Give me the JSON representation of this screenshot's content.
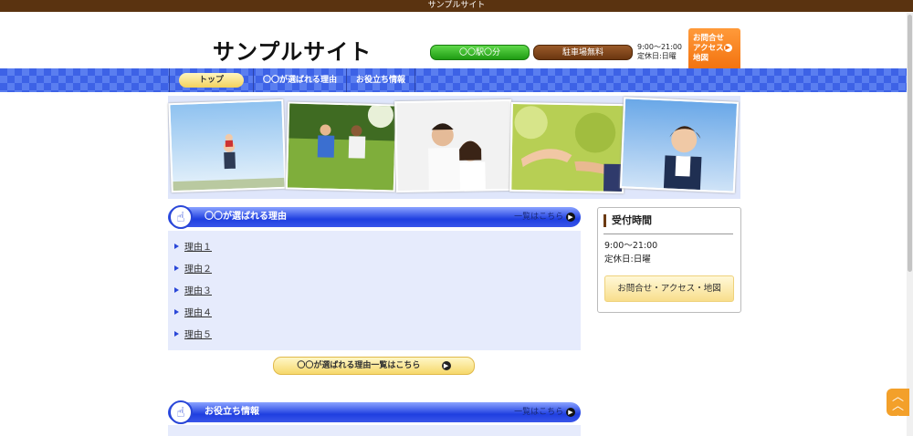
{
  "topbar": {
    "title": "サンプルサイト"
  },
  "header": {
    "site_title": "サンプルサイト",
    "station_label": "〇〇駅〇分",
    "parking_label": "駐車場無料",
    "hours": "9:00～21:00",
    "closed": "定休日:日曜",
    "contact_line1": "お問合せ",
    "contact_line2": "アクセス",
    "contact_line3": "地図"
  },
  "nav": {
    "items": [
      {
        "label": "トップ"
      },
      {
        "label": "〇〇が選ばれる理由"
      },
      {
        "label": "お役立ち情報"
      }
    ]
  },
  "reasons_section": {
    "title": "〇〇が選ばれる理由",
    "link": "一覧はこちら",
    "items": [
      "理由１",
      "理由２",
      "理由３",
      "理由４",
      "理由５"
    ],
    "more_button": "〇〇が選ばれる理由一覧はこちら"
  },
  "info_section": {
    "title": "お役立ち情報",
    "link": "一覧はこちら"
  },
  "sidebar": {
    "title": "受付時間",
    "hours": "9:00～21:00",
    "closed": "定休日:日曜",
    "button": "お問合せ・アクセス・地図"
  },
  "hero": {
    "photos": [
      "family-sky-photo",
      "children-running-photo",
      "couple-smiling-photo",
      "holding-hands-photo",
      "woman-smiling-photo"
    ]
  },
  "colors": {
    "brown": "#5a3310",
    "blue": "#2a47d8",
    "orange": "#f06a06",
    "green": "#1f9c13",
    "light_blue_bg": "#e6ebfc"
  }
}
